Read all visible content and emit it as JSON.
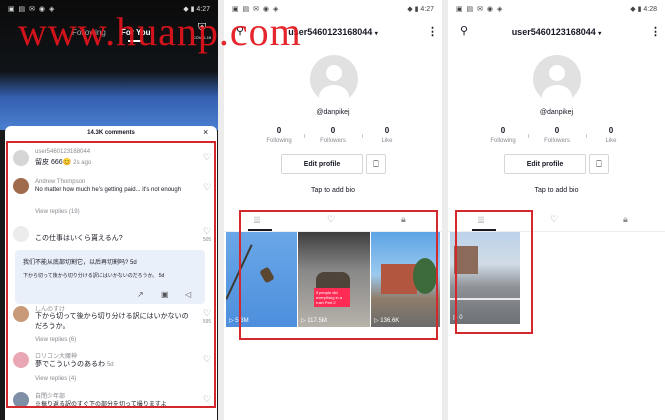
{
  "watermark": "www.huanp.com",
  "phone1": {
    "status": {
      "left": "▣ ▤ ✉ ◉ ◈",
      "right": "◆ ▮ 4:27"
    },
    "tabs": {
      "following": "Following",
      "for_you": "For You",
      "covid": "COVID-19"
    },
    "comments": {
      "count": "14.3K comments",
      "close": "×",
      "items": [
        {
          "user": "user54601231680​44",
          "text": "留皮 666😊",
          "time": "2s ago",
          "likes": ""
        },
        {
          "user": "Andrew Thompson",
          "text": "No matter how much he's getting paid... it's not enough",
          "time": "5d",
          "likes": ""
        },
        {
          "user": "Vieew replies (19)",
          "text": "",
          "time": "",
          "likes": ""
        },
        {
          "user": "",
          "text": "この仕事はいくら貰えるん?",
          "time": "5d",
          "likes": "505"
        }
      ],
      "view_replies_1": "View replies (19)",
      "popup": {
        "title": "我们不能从底部切割它，以后再切割吗? 5d",
        "subtitle": "下から切って後から切り分ける訳にはいかないのだろうか。 5d"
      },
      "item5": {
        "user": "しんのすけ",
        "text": "下から切って後から切り分ける訳にはいかないのだろうか。",
        "time": "5d",
        "likes": "595"
      },
      "view_replies_2": "View replies (6)",
      "item6": {
        "user": "ロリコン大魔神",
        "text": "夢でこういうのあるわ",
        "time": "5d",
        "likes": ""
      },
      "view_replies_3": "View replies (4)",
      "item7": {
        "user": "自閉少年部",
        "text": "※振り返る訳のすぐ下の部分を切って撮りますよ",
        "time": "5d",
        "likes": ""
      }
    }
  },
  "phone2": {
    "status": {
      "left": "▣ ▤ ✉ ◉ ◈",
      "right": "◆ ▮ 4:27"
    },
    "username": "user5460123168044",
    "handle": "@danpikej",
    "stats": [
      {
        "num": "0",
        "label": "Following"
      },
      {
        "num": "0",
        "label": "Followers"
      },
      {
        "num": "0",
        "label": "Like"
      }
    ],
    "edit_profile": "Edit profile",
    "bio": "Tap to add bio",
    "videos": [
      {
        "views": "5.3M",
        "caption": ""
      },
      {
        "views": "117.5M",
        "caption": "if people did everything in a rush Part 2"
      },
      {
        "views": "136.6K",
        "caption": ""
      }
    ]
  },
  "phone3": {
    "status": {
      "left": "▣ ▤ ✉ ◉ ◈",
      "right": "◆ ▮ 4:28"
    },
    "username": "user5460123168044",
    "handle": "@danpikej",
    "stats": [
      {
        "num": "0",
        "label": "Following"
      },
      {
        "num": "0",
        "label": "Followers"
      },
      {
        "num": "0",
        "label": "Like"
      }
    ],
    "edit_profile": "Edit profile",
    "bio": "Tap to add bio",
    "videos": [
      {
        "views": "0",
        "caption": ""
      }
    ]
  },
  "colors": {
    "highlight": "#d4282d",
    "pink": "#fe2c55"
  }
}
